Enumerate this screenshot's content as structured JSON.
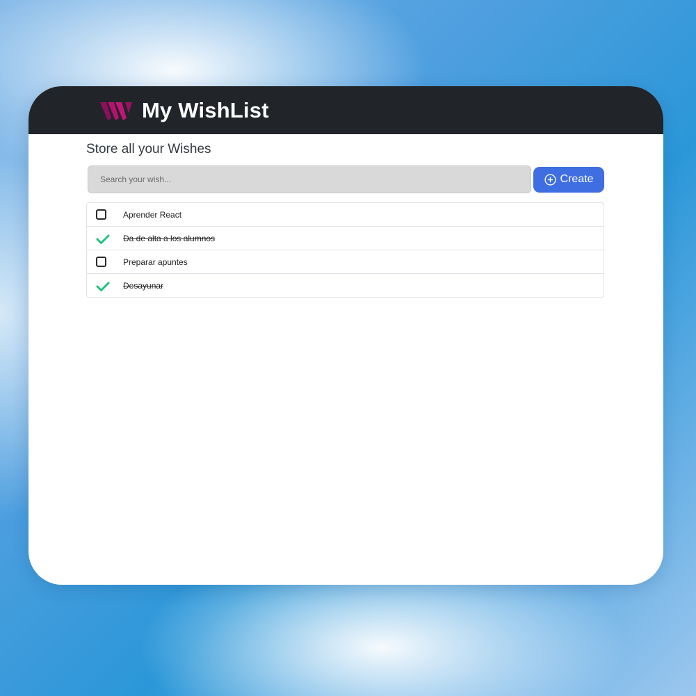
{
  "header": {
    "brand_title": "My WishList",
    "logo_icon": "wishlist-w-logo"
  },
  "main": {
    "subtitle": "Store all your Wishes",
    "search": {
      "placeholder": "Search your wish...",
      "value": ""
    },
    "create_button": {
      "label": "Create",
      "icon": "plus-circle-icon"
    }
  },
  "wishes": [
    {
      "text": "Aprender React",
      "done": false
    },
    {
      "text": "Da de alta a los alumnos",
      "done": true
    },
    {
      "text": "Preparar apuntes",
      "done": false
    },
    {
      "text": "Desayunar",
      "done": true
    }
  ],
  "colors": {
    "navbar": "#212529",
    "primary": "#3f6ee3",
    "done_check": "#20c27a",
    "logo_magenta": "#b4126e"
  }
}
